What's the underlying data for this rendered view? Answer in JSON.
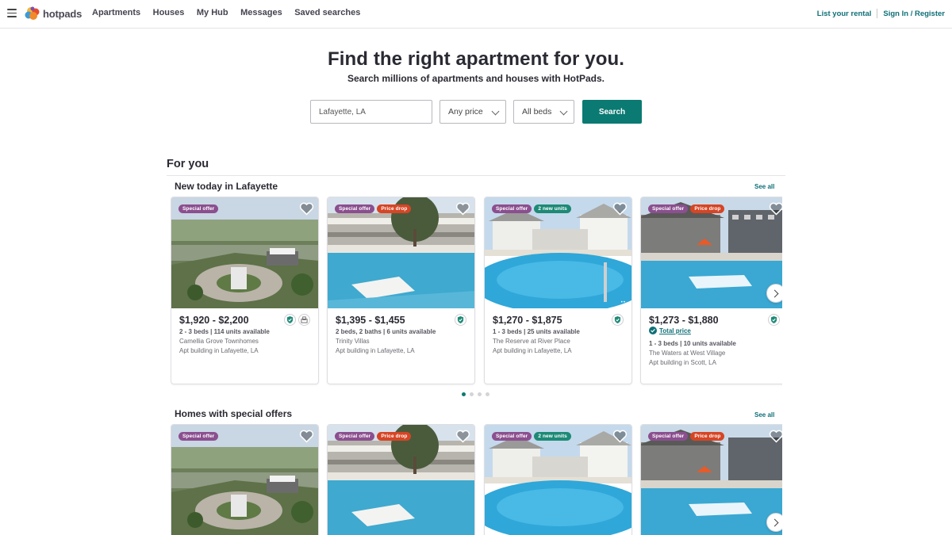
{
  "nav": {
    "logo_text": "hotpads",
    "links": [
      "Apartments",
      "Houses",
      "My Hub",
      "Messages",
      "Saved searches"
    ],
    "list_rental": "List your rental",
    "sign_in": "Sign In / Register"
  },
  "hero": {
    "title": "Find the right apartment for you.",
    "subtitle": "Search millions of apartments and houses with HotPads.",
    "location_value": "Lafayette, LA",
    "price_select": "Any price",
    "beds_select": "All beds",
    "search_button": "Search"
  },
  "section_title": "For you",
  "rows": [
    {
      "title": "New today in Lafayette",
      "see_all": "See all",
      "cards": [
        {
          "badges": [
            "Special offer"
          ],
          "price": "$1,920 - $2,200",
          "units": "2 - 3 beds | 114 units available",
          "name": "Camellia Grove Townhomes",
          "type": "Apt building in Lafayette, LA"
        },
        {
          "badges": [
            "Special offer",
            "Price drop"
          ],
          "price": "$1,395 - $1,455",
          "units": "2 beds, 2 baths | 6 units available",
          "name": "Trinity Villas",
          "type": "Apt building in Lafayette, LA"
        },
        {
          "badges": [
            "Special offer",
            "2 new units"
          ],
          "price": "$1,270 - $1,875",
          "units": "1 - 3 beds | 25 units available",
          "name": "The Reserve at River Place",
          "type": "Apt building in Lafayette, LA"
        },
        {
          "badges": [
            "Special offer",
            "Price drop"
          ],
          "price": "$1,273 - $1,880",
          "total_price": "Total price",
          "units": "1 - 3 beds | 10 units available",
          "name": "The Waters at West Village",
          "type": "Apt building in Scott, LA"
        }
      ]
    },
    {
      "title": "Homes with special offers",
      "see_all": "See all",
      "cards": [
        {
          "badges": [
            "Special offer"
          ]
        },
        {
          "badges": [
            "Special offer",
            "Price drop"
          ]
        },
        {
          "badges": [
            "Special offer",
            "2 new units"
          ]
        },
        {
          "badges": [
            "Special offer",
            "Price drop"
          ]
        }
      ]
    }
  ],
  "colors": {
    "special_offer": "#8b4f8f",
    "price_drop": "#d64525",
    "new_units": "#1d8a76",
    "accent": "#0b7a72",
    "link": "#0e6f77"
  }
}
